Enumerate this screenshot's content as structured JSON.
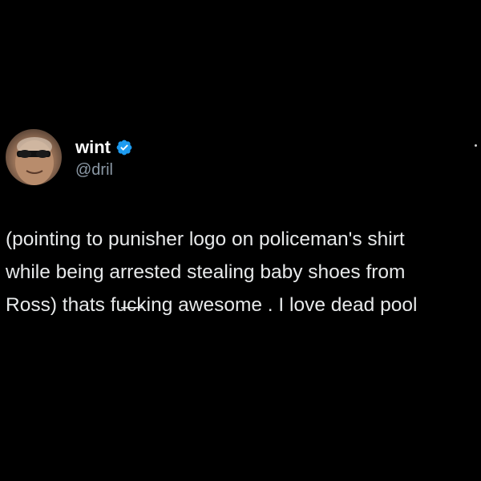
{
  "tweet": {
    "author": {
      "display_name": "wint",
      "handle": "@dril",
      "verified_icon": "verified-badge-icon",
      "avatar_icon": "avatar-icon"
    },
    "text_lines": [
      "(pointing to punisher logo on policeman's shirt",
      "while being arrested stealing baby shoes from",
      "Ross) thats fu̶c̶king awesome . I love dead pool"
    ],
    "colors": {
      "background": "#000000",
      "name": "#ffffff",
      "handle": "#8b98a5",
      "text": "#e7e9ea",
      "verified": "#1d9bf0"
    }
  }
}
